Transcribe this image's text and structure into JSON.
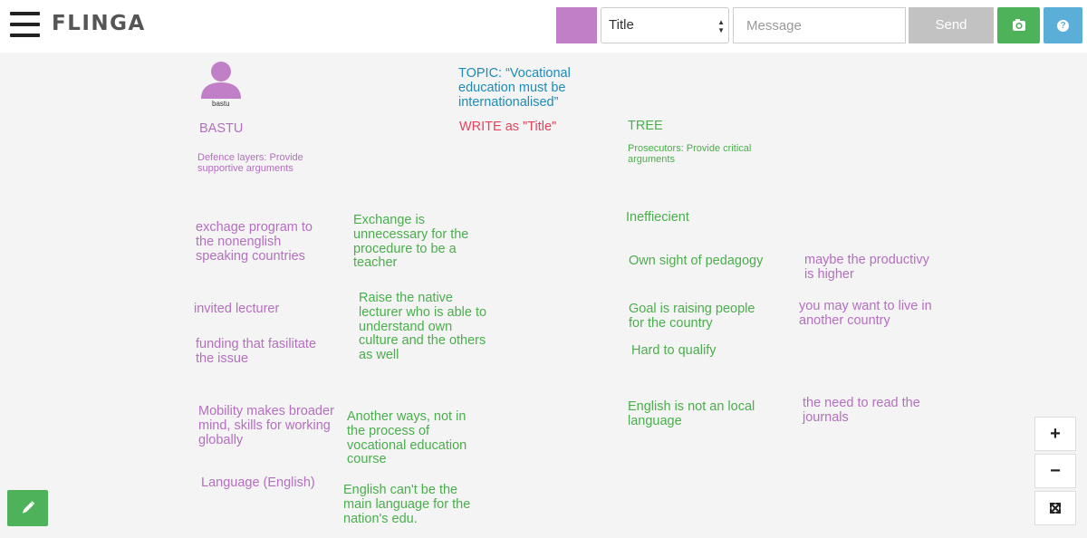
{
  "header": {
    "logo": "FLINGA",
    "color_swatch": "#c07fc6",
    "title_select_value": "Title",
    "message_placeholder": "Message",
    "send_label": "Send",
    "camera_icon": "camera-icon",
    "help_icon": "?"
  },
  "board": {
    "user": {
      "name": "bastu"
    },
    "topic": "TOPIC: “Vocational education must be internationalised”",
    "instruction": "WRITE as \"Title\"",
    "team_a": {
      "name": "BASTU",
      "description": "Defence layers: Provide supportive arguments"
    },
    "team_b": {
      "name": "TREE",
      "description": "Prosecutors: Provide critical arguments"
    },
    "notes": [
      "exchage program to the nonenglish speaking countries",
      "Exchange is unnecessary for the procedure to be a teacher",
      "Ineffiecient",
      "Own sight of pedagogy",
      "maybe the productivy is higher",
      "invited lecturer",
      "Raise the native lecturer who is able to understand own culture and the others as well",
      "Goal is raising people for the country",
      "you may want to live in another country",
      "funding that fasilitate the issue",
      "Hard to qualify",
      "Mobility makes broader mind, skills for working globally",
      "Another ways, not in the process of vocational education course",
      "English is not an local language",
      "the need to read the journals",
      "Language (English)",
      "English can't be the main language for the nation's edu."
    ]
  },
  "controls": {
    "zoom_in": "+",
    "zoom_out": "−",
    "fit_icon": "expand-icon",
    "edit_icon": "pencil-icon"
  },
  "colors": {
    "purple": "#b46fc0",
    "green": "#4aae4c",
    "teal": "#1d8bb5",
    "red": "#e8415d",
    "send_gray": "#c2c2c2",
    "camera_green": "#4db25a",
    "help_blue": "#5aaed8"
  }
}
